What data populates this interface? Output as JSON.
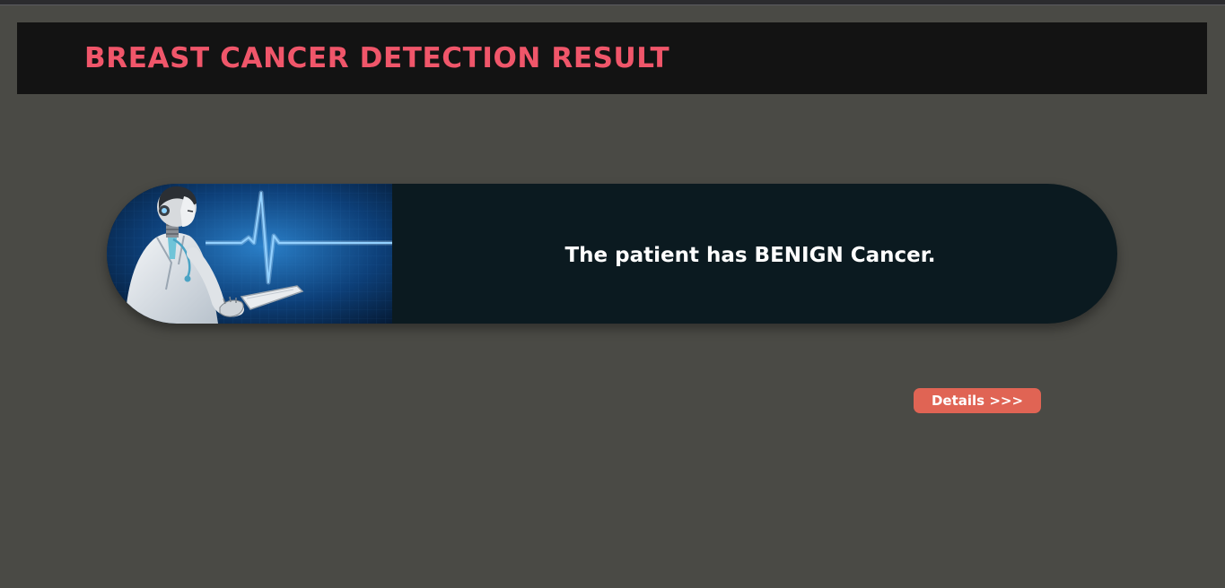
{
  "header": {
    "title": "BREAST CANCER DETECTION RESULT"
  },
  "result": {
    "message": "The patient has BENIGN Cancer.",
    "image_icon": "robot-doctor-heartbeat-illustration"
  },
  "actions": {
    "details_label": "Details >>>"
  },
  "colors": {
    "page_background": "#4a4a45",
    "header_background": "#131313",
    "title_color": "#f0566a",
    "card_background": "#0b1a20",
    "button_color": "#e06454"
  }
}
